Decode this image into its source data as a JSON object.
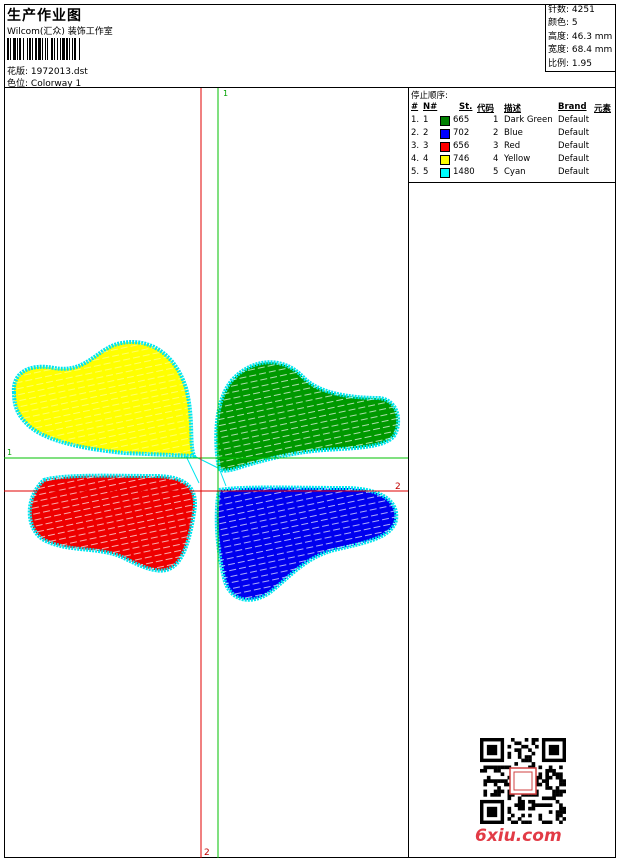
{
  "header": {
    "title": "生产作业图",
    "company": "Wilcom(汇众) 装饰工作室",
    "design_label": "花版:",
    "design_value": "1972013.dst",
    "colorway_label": "色位:",
    "colorway_value": "Colorway 1"
  },
  "stats": {
    "stitches": "针数: 4251",
    "colors": "颜色: 5",
    "height": "高度: 46.3 mm",
    "width": "宽度: 68.4 mm",
    "ratio": "比例: 1.95"
  },
  "stop_sequence": {
    "title": "停止顺序:",
    "headers": {
      "seq": "#",
      "needle": "N#",
      "stitches": "St.",
      "code": "代码",
      "desc": "描述",
      "brand": "Brand",
      "element": "元素"
    },
    "rows": [
      {
        "seq": "1.",
        "needle": "1",
        "stitches": "665",
        "code": "1",
        "desc": "Dark Green",
        "brand": "Default",
        "color": "#008000"
      },
      {
        "seq": "2.",
        "needle": "2",
        "stitches": "702",
        "code": "2",
        "desc": "Blue",
        "brand": "Default",
        "color": "#0000ff"
      },
      {
        "seq": "3.",
        "needle": "3",
        "stitches": "656",
        "code": "3",
        "desc": "Red",
        "brand": "Default",
        "color": "#ff0000"
      },
      {
        "seq": "4.",
        "needle": "4",
        "stitches": "746",
        "code": "4",
        "desc": "Yellow",
        "brand": "Default",
        "color": "#ffff00"
      },
      {
        "seq": "5.",
        "needle": "5",
        "stitches": "1480",
        "code": "5",
        "desc": "Cyan",
        "brand": "Default",
        "color": "#00ffff"
      }
    ]
  },
  "guides": {
    "v_green": "1",
    "h_green": "1",
    "h_red": "2",
    "v_red": "2"
  },
  "watermark": "6xiu.com",
  "colors": {
    "green_guide": "#00c000",
    "red_guide": "#e00000"
  }
}
